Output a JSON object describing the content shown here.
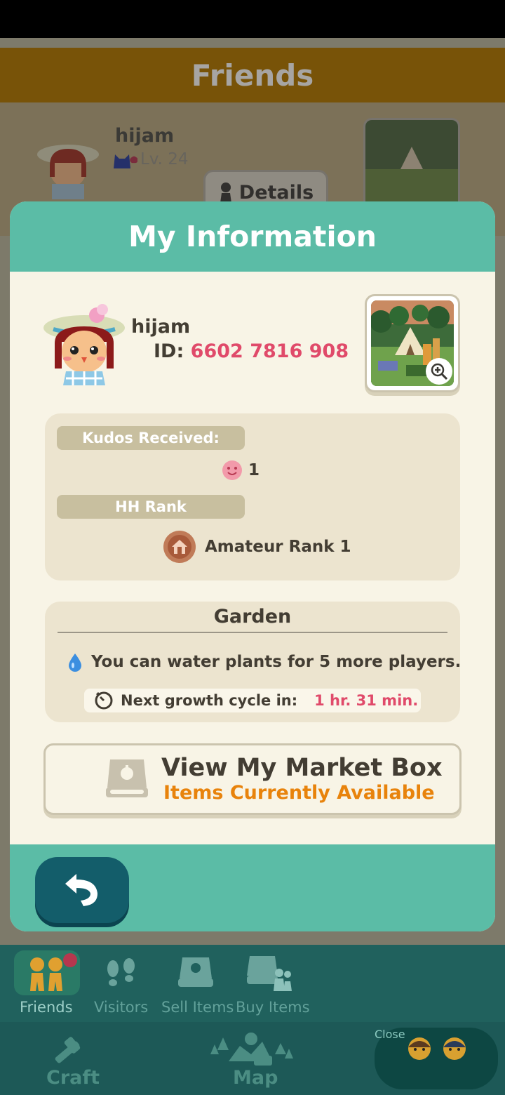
{
  "background": {
    "title": "Friends",
    "friend": {
      "name": "hijam",
      "level": "Lv. 24",
      "details_label": "Details"
    }
  },
  "modal": {
    "title": "My Information",
    "player": {
      "name": "hijam",
      "id_label": "ID:",
      "id_value": "6602 7816 908"
    },
    "kudos": {
      "label": "Kudos Received:",
      "count": "1"
    },
    "rank": {
      "label": "HH Rank",
      "value": "Amateur Rank 1"
    },
    "garden": {
      "title": "Garden",
      "water_text": "You can water plants for 5 more players.",
      "growth_label": "Next growth cycle in:",
      "growth_time": "1 hr. 31 min."
    },
    "market": {
      "title": "View My Market Box",
      "subtitle": "Items Currently Available"
    }
  },
  "subnav": {
    "items": [
      {
        "label": "Friends",
        "active": true
      },
      {
        "label": "Visitors"
      },
      {
        "label": "Sell Items"
      },
      {
        "label": "Buy Items"
      }
    ]
  },
  "mainnav": {
    "craft": "Craft",
    "map": "Map",
    "close": "Close"
  },
  "colors": {
    "teal": "#5bbca6",
    "cream": "#f8f4e6",
    "accent_pink": "#e04a6a",
    "accent_orange": "#e8830c",
    "nav_dark": "#1d5957"
  }
}
